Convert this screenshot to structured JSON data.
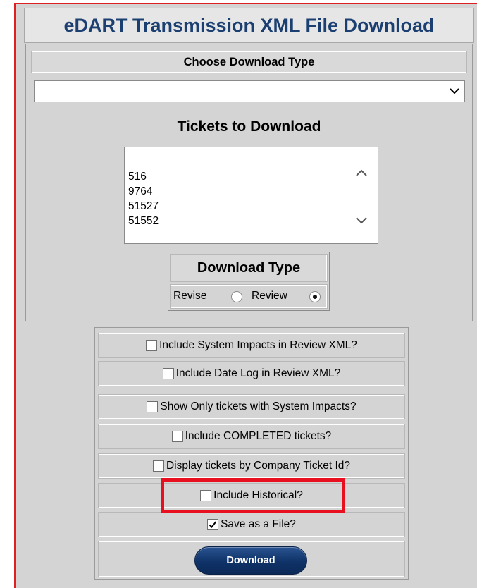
{
  "app": {
    "title": "eDART Transmission XML File Download"
  },
  "download_type_select": {
    "header": "Choose Download Type",
    "selected_value": ""
  },
  "tickets": {
    "label": "Tickets to Download",
    "items": [
      "516",
      "9764",
      "51527",
      "51552"
    ]
  },
  "download_type": {
    "title": "Download Type",
    "options": [
      {
        "label": "Revise",
        "selected": false
      },
      {
        "label": "Review",
        "selected": true
      }
    ]
  },
  "options": [
    {
      "label": "Include System Impacts in Review XML?",
      "checked": false
    },
    {
      "label": "Include Date Log in Review XML?",
      "checked": false
    },
    {
      "label": "Show Only tickets with System Impacts?",
      "checked": false
    },
    {
      "label": "Include COMPLETED tickets?",
      "checked": false
    },
    {
      "label": "Display tickets by Company Ticket Id?",
      "checked": false
    },
    {
      "label": "Include Historical?",
      "checked": false
    },
    {
      "label": "Save as a File?",
      "checked": true
    }
  ],
  "actions": {
    "download_label": "Download"
  },
  "colors": {
    "title": "#1c3f72",
    "button": "#0f3268",
    "highlight": "#e8101e",
    "background": "#d4d4d4"
  }
}
